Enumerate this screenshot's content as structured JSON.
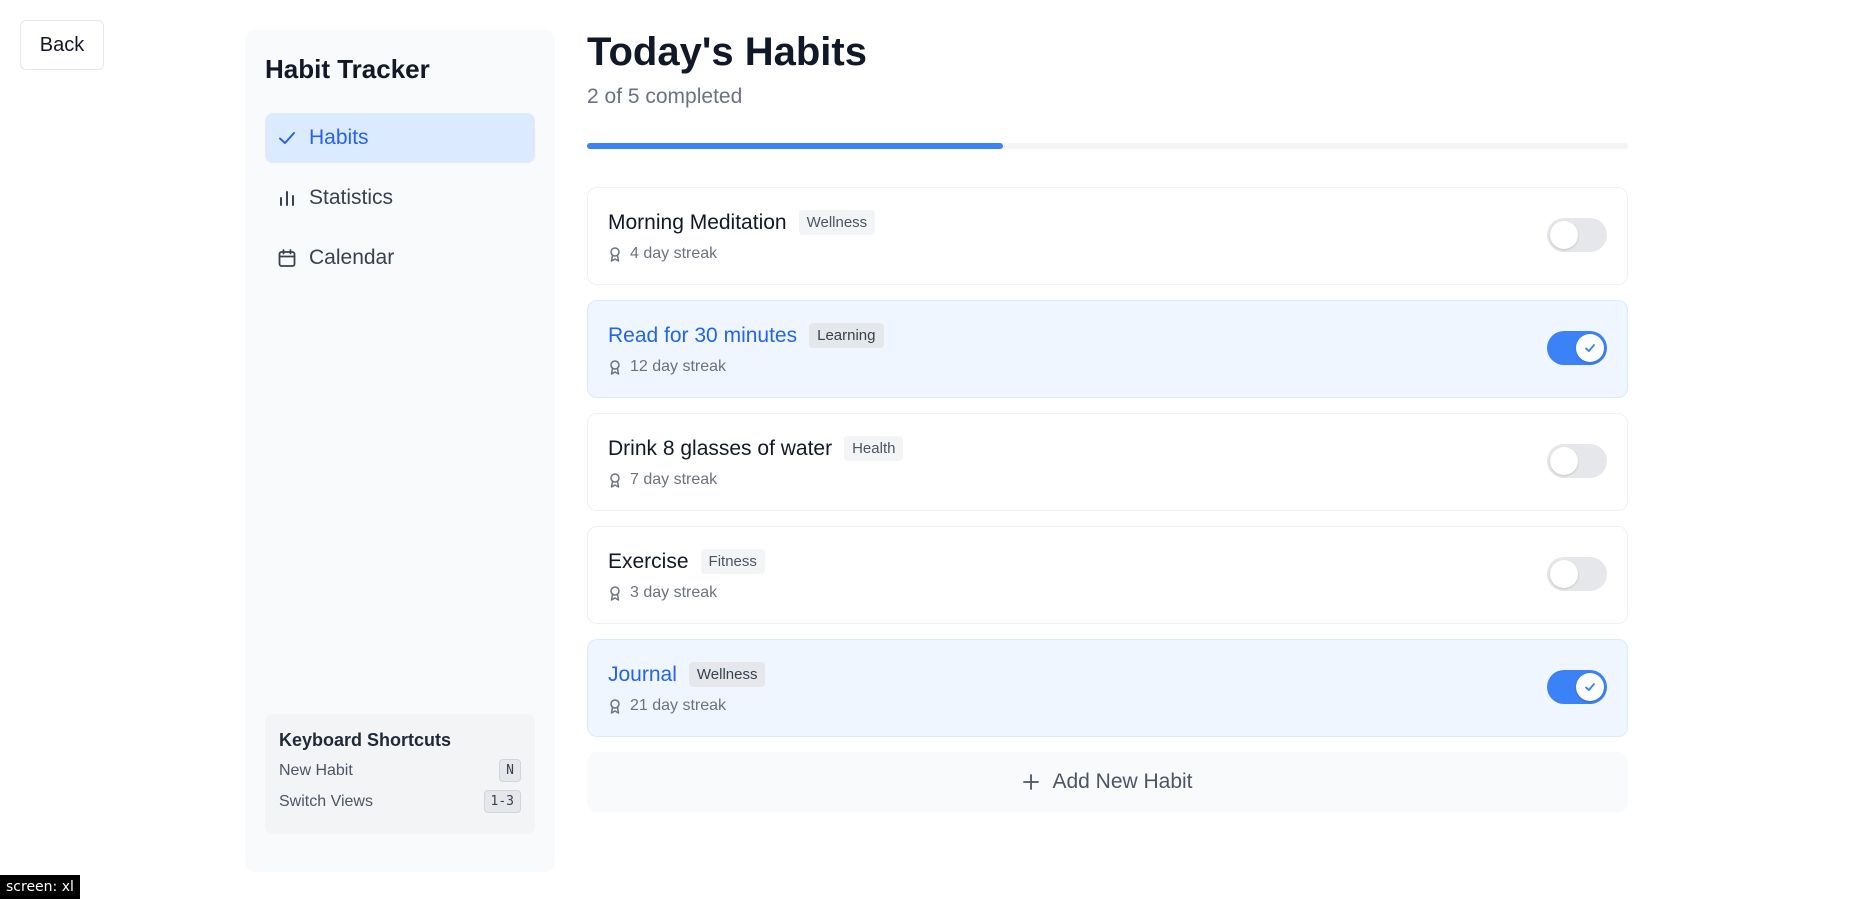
{
  "back_label": "Back",
  "sidebar": {
    "title": "Habit Tracker",
    "items": [
      {
        "label": "Habits",
        "icon": "check-icon",
        "active": true
      },
      {
        "label": "Statistics",
        "icon": "bar-chart-icon",
        "active": false
      },
      {
        "label": "Calendar",
        "icon": "calendar-icon",
        "active": false
      }
    ],
    "shortcuts": {
      "title": "Keyboard Shortcuts",
      "rows": [
        {
          "label": "New Habit",
          "key": "N"
        },
        {
          "label": "Switch Views",
          "key": "1-3"
        }
      ]
    }
  },
  "main": {
    "title": "Today's Habits",
    "subtitle": "2 of 5 completed",
    "progress": 0.4,
    "habits": [
      {
        "name": "Morning Meditation",
        "tag": "Wellness",
        "streak": "4 day streak",
        "done": false
      },
      {
        "name": "Read for 30 minutes",
        "tag": "Learning",
        "streak": "12 day streak",
        "done": true
      },
      {
        "name": "Drink 8 glasses of water",
        "tag": "Health",
        "streak": "7 day streak",
        "done": false
      },
      {
        "name": "Exercise",
        "tag": "Fitness",
        "streak": "3 day streak",
        "done": false
      },
      {
        "name": "Journal",
        "tag": "Wellness",
        "streak": "21 day streak",
        "done": true
      }
    ],
    "add_label": "Add New Habit"
  },
  "screen_badge": "screen: xl",
  "colors": {
    "accent": "#3b82f6",
    "accent_text": "#2563eb",
    "done_bg": "#eff6ff"
  }
}
